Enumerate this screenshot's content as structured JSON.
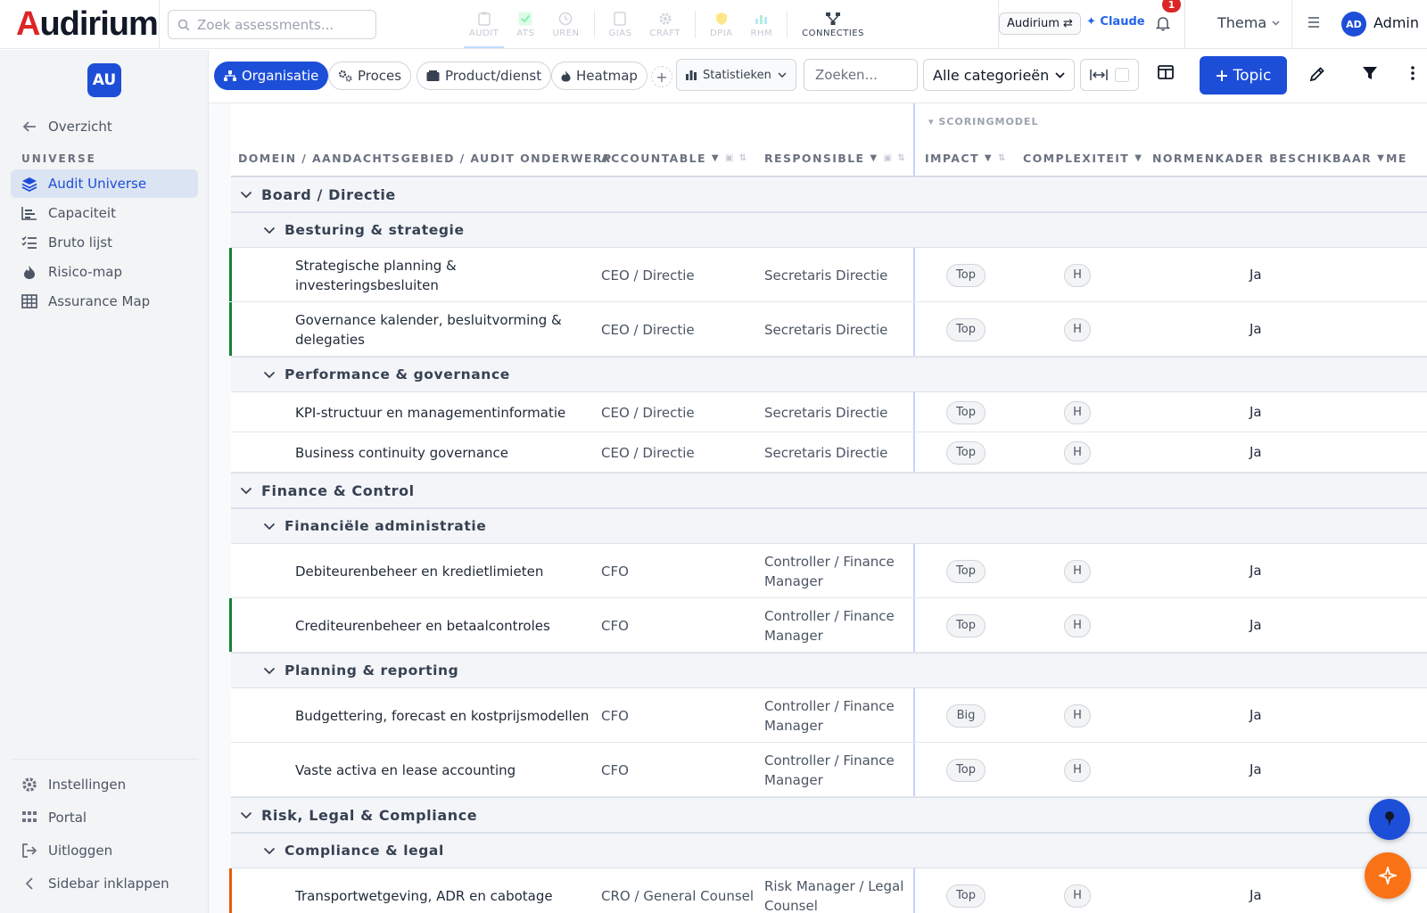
{
  "app": {
    "logo_initial": "A",
    "logo_rest": "udirium",
    "search_placeholder": "Zoek assessments..."
  },
  "modules": [
    {
      "label": "AUDIT",
      "icon": "clipboard-icon"
    },
    {
      "label": "ATS",
      "icon": "check-icon"
    },
    {
      "label": "UREN",
      "icon": "clock-icon"
    },
    {
      "label": "GIAS",
      "icon": "doc-icon"
    },
    {
      "label": "CRAFT",
      "icon": "gear-icon"
    },
    {
      "label": "DPIA",
      "icon": "shield-icon"
    },
    {
      "label": "RHM",
      "icon": "chart-icon"
    },
    {
      "label": "CONNECTIES",
      "icon": "network-icon"
    }
  ],
  "header_right": {
    "workspace": "Audirium ⇄",
    "claude": "✦ Claude",
    "notifications": "1",
    "theme": "Thema",
    "avatar": "AD",
    "user": "Admin"
  },
  "sidebar": {
    "avatar": "AU",
    "back": "Overzicht",
    "section": "UNIVERSE",
    "items": [
      {
        "label": "Audit Universe",
        "icon": "layers-icon"
      },
      {
        "label": "Capaciteit",
        "icon": "capacity-chart-icon"
      },
      {
        "label": "Bruto lijst",
        "icon": "checklist-icon"
      },
      {
        "label": "Risico-map",
        "icon": "flame-icon"
      },
      {
        "label": "Assurance Map",
        "icon": "grid-icon"
      }
    ],
    "footer": [
      {
        "label": "Instellingen",
        "icon": "gear-icon"
      },
      {
        "label": "Portal",
        "icon": "apps-icon"
      },
      {
        "label": "Uitloggen",
        "icon": "logout-icon"
      },
      {
        "label": "Sidebar inklappen",
        "icon": "chevron-left-icon"
      }
    ]
  },
  "toolbar": {
    "tabs": [
      {
        "label": "Organisatie",
        "icon": "org-icon"
      },
      {
        "label": "Proces",
        "icon": "process-icon"
      },
      {
        "label": "Product/dienst",
        "icon": "box-icon"
      },
      {
        "label": "Heatmap",
        "icon": "flame-icon"
      }
    ],
    "stats": "Statistieken",
    "search_placeholder": "Zoeken...",
    "category": "Alle categorieën",
    "topic_button": "Topic"
  },
  "table": {
    "section_label": "▾ SCORINGMODEL",
    "headers": {
      "topic": "DOMEIN / AANDACHTSGEBIED / AUDIT ONDERWERP",
      "accountable": "ACCOUNTABLE",
      "responsible": "RESPONSIBLE",
      "impact": "IMPACT",
      "complexity": "COMPLEXITEIT",
      "norm": "NORMENKADER BESCHIKBAAR",
      "more": "ME"
    },
    "groups": [
      {
        "domain": "Board / Directie",
        "subs": [
          {
            "name": "Besturing & strategie",
            "rows": [
              {
                "topic": "Strategische planning & investeringsbesluiten",
                "acc": "CEO / Directie",
                "resp": "Secretaris Directie",
                "impact": "Top",
                "cx": "H",
                "norm": "Ja",
                "bar": "#15803d"
              },
              {
                "topic": "Governance kalender, besluitvorming & delegaties",
                "acc": "CEO / Directie",
                "resp": "Secretaris Directie",
                "impact": "Top",
                "cx": "H",
                "norm": "Ja",
                "bar": "#15803d"
              }
            ]
          },
          {
            "name": "Performance & governance",
            "rows": [
              {
                "topic": "KPI-structuur en managementinformatie",
                "acc": "CEO / Directie",
                "resp": "Secretaris Directie",
                "impact": "Top",
                "cx": "H",
                "norm": "Ja",
                "bar": ""
              },
              {
                "topic": "Business continuity governance",
                "acc": "CEO / Directie",
                "resp": "Secretaris Directie",
                "impact": "Top",
                "cx": "H",
                "norm": "Ja",
                "bar": ""
              }
            ]
          }
        ]
      },
      {
        "domain": "Finance & Control",
        "subs": [
          {
            "name": "Financiële administratie",
            "rows": [
              {
                "topic": "Debiteurenbeheer en kredietlimieten",
                "acc": "CFO",
                "resp": "Controller / Finance Manager",
                "impact": "Top",
                "cx": "H",
                "norm": "Ja",
                "bar": ""
              },
              {
                "topic": "Crediteurenbeheer en betaalcontroles",
                "acc": "CFO",
                "resp": "Controller / Finance Manager",
                "impact": "Top",
                "cx": "H",
                "norm": "Ja",
                "bar": "#15803d"
              }
            ]
          },
          {
            "name": "Planning & reporting",
            "rows": [
              {
                "topic": "Budgettering, forecast en kostprijsmodellen",
                "acc": "CFO",
                "resp": "Controller / Finance Manager",
                "impact": "Big",
                "cx": "H",
                "norm": "Ja",
                "bar": ""
              },
              {
                "topic": "Vaste activa en lease accounting",
                "acc": "CFO",
                "resp": "Controller / Finance Manager",
                "impact": "Top",
                "cx": "H",
                "norm": "Ja",
                "bar": ""
              }
            ]
          }
        ]
      },
      {
        "domain": "Risk, Legal & Compliance",
        "subs": [
          {
            "name": "Compliance & legal",
            "rows": [
              {
                "topic": "Transportwetgeving, ADR en cabotage",
                "acc": "CRO / General Counsel",
                "resp": "Risk Manager / Legal Counsel",
                "impact": "Top",
                "cx": "H",
                "norm": "Ja",
                "bar": "#ea580c"
              }
            ]
          }
        ]
      }
    ]
  }
}
